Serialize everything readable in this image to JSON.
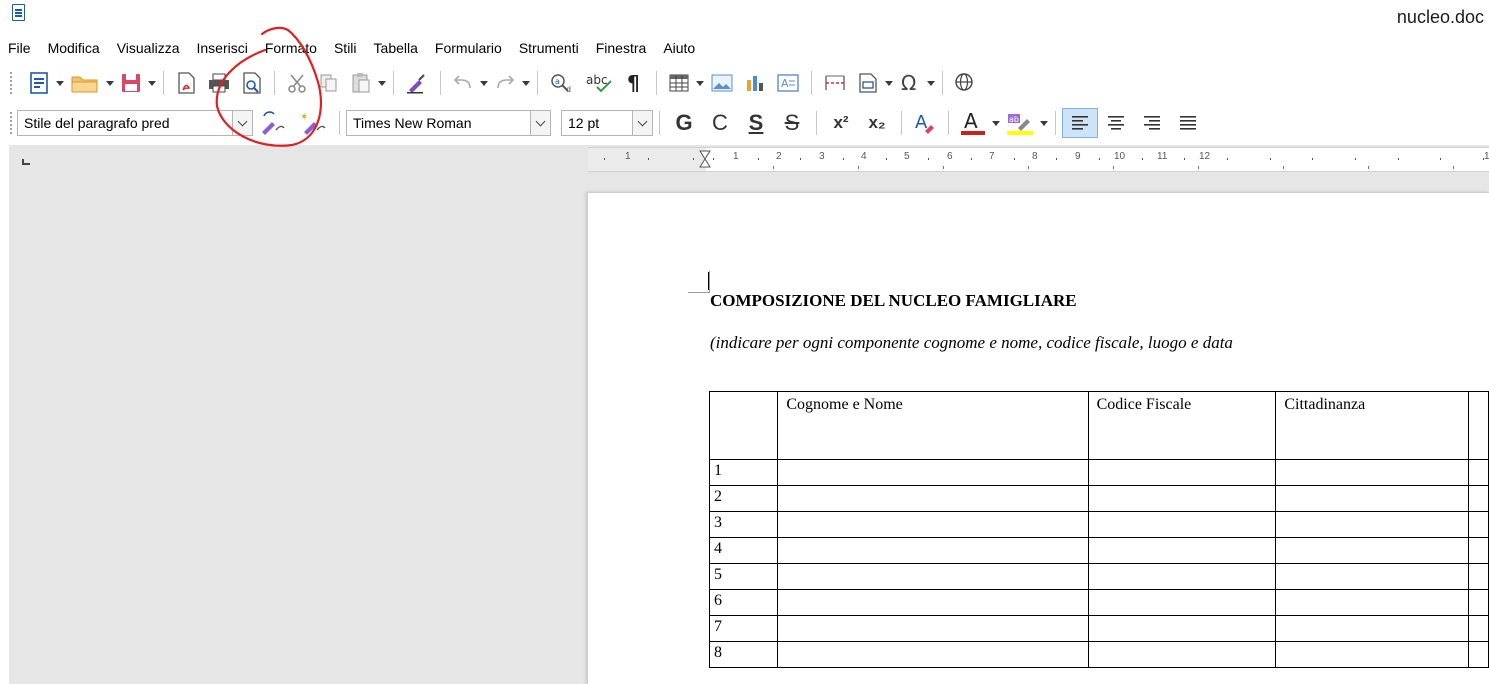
{
  "window": {
    "title": "nucleo.doc"
  },
  "menu": [
    "File",
    "Modifica",
    "Visualizza",
    "Inserisci",
    "Formato",
    "Stili",
    "Tabella",
    "Formulario",
    "Strumenti",
    "Finestra",
    "Aiuto"
  ],
  "toolbar2": {
    "paragraph_style": "Stile del paragrafo pred",
    "font_name": "Times New Roman",
    "font_size": "12 pt",
    "bold": "G",
    "italic": "C",
    "underline": "S",
    "strikethrough": "S",
    "superscript": "x²",
    "subscript": "x₂"
  },
  "ruler": {
    "numbers": [
      "1",
      "1",
      "2",
      "3",
      "4",
      "5",
      "6",
      "7",
      "8",
      "9",
      "10",
      "11",
      "12",
      "1"
    ]
  },
  "document": {
    "title": "COMPOSIZIONE DEL NUCLEO FAMIGLIARE",
    "subtitle": "(indicare per ogni componente cognome e nome, codice fiscale, luogo e data",
    "table": {
      "headers": [
        "",
        "Cognome e Nome",
        "Codice Fiscale",
        "Cittadinanza",
        ""
      ],
      "row_numbers": [
        "1",
        "2",
        "3",
        "4",
        "5",
        "6",
        "7",
        "8"
      ]
    }
  },
  "colors": {
    "accent": "#1e5aa8",
    "annotation": "#e02020",
    "workspace": "#e6e6e6"
  }
}
